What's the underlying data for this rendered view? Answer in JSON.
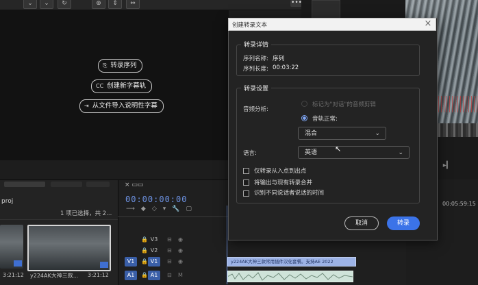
{
  "monitor": {
    "transcribe_sequence": "转录序列",
    "create_captions": "创建新字幕轨",
    "import_captions": "从文件导入说明性字幕"
  },
  "project": {
    "path": "proj",
    "selection": "1 项已选择，共 2...",
    "clips": [
      {
        "duration": "3:21:12"
      },
      {
        "name": "y224AK大神三款...",
        "duration": "3:21:12"
      }
    ]
  },
  "timeline": {
    "timecode": "00:00:00:00",
    "tracks": [
      {
        "source": "",
        "target": "V3"
      },
      {
        "source": "",
        "target": "V2"
      },
      {
        "source": "V1",
        "target": "V1"
      },
      {
        "source": "A1",
        "target": "A1"
      }
    ],
    "clip_label": "y224AK大神三款常用插件汉化套餐。支持AE 2022"
  },
  "source_monitor": {
    "timecode": "00:05:59:15"
  },
  "dialog": {
    "title": "创建转录文本",
    "details_legend": "转录详情",
    "sequence_name_label": "序列名称:",
    "sequence_name": "序列",
    "sequence_length_label": "序列长度:",
    "sequence_length": "00:03:22",
    "settings_legend": "转录设置",
    "audio_analysis_label": "音频分析:",
    "option_dialogue": "标记为\"对话\"的音频剪辑",
    "option_track": "音轨正常:",
    "mix_value": "混合",
    "language_label": "语言:",
    "language_value": "英语",
    "checkbox_in_out": "仅转录从入点到出点",
    "checkbox_merge": "将输出与现有转录合并",
    "checkbox_speakers": "识别不同说话者说话的时间",
    "cancel": "取消",
    "transcribe": "转录"
  },
  "colors": {
    "accent": "#3b73e8",
    "timecode": "#6f95e8"
  }
}
